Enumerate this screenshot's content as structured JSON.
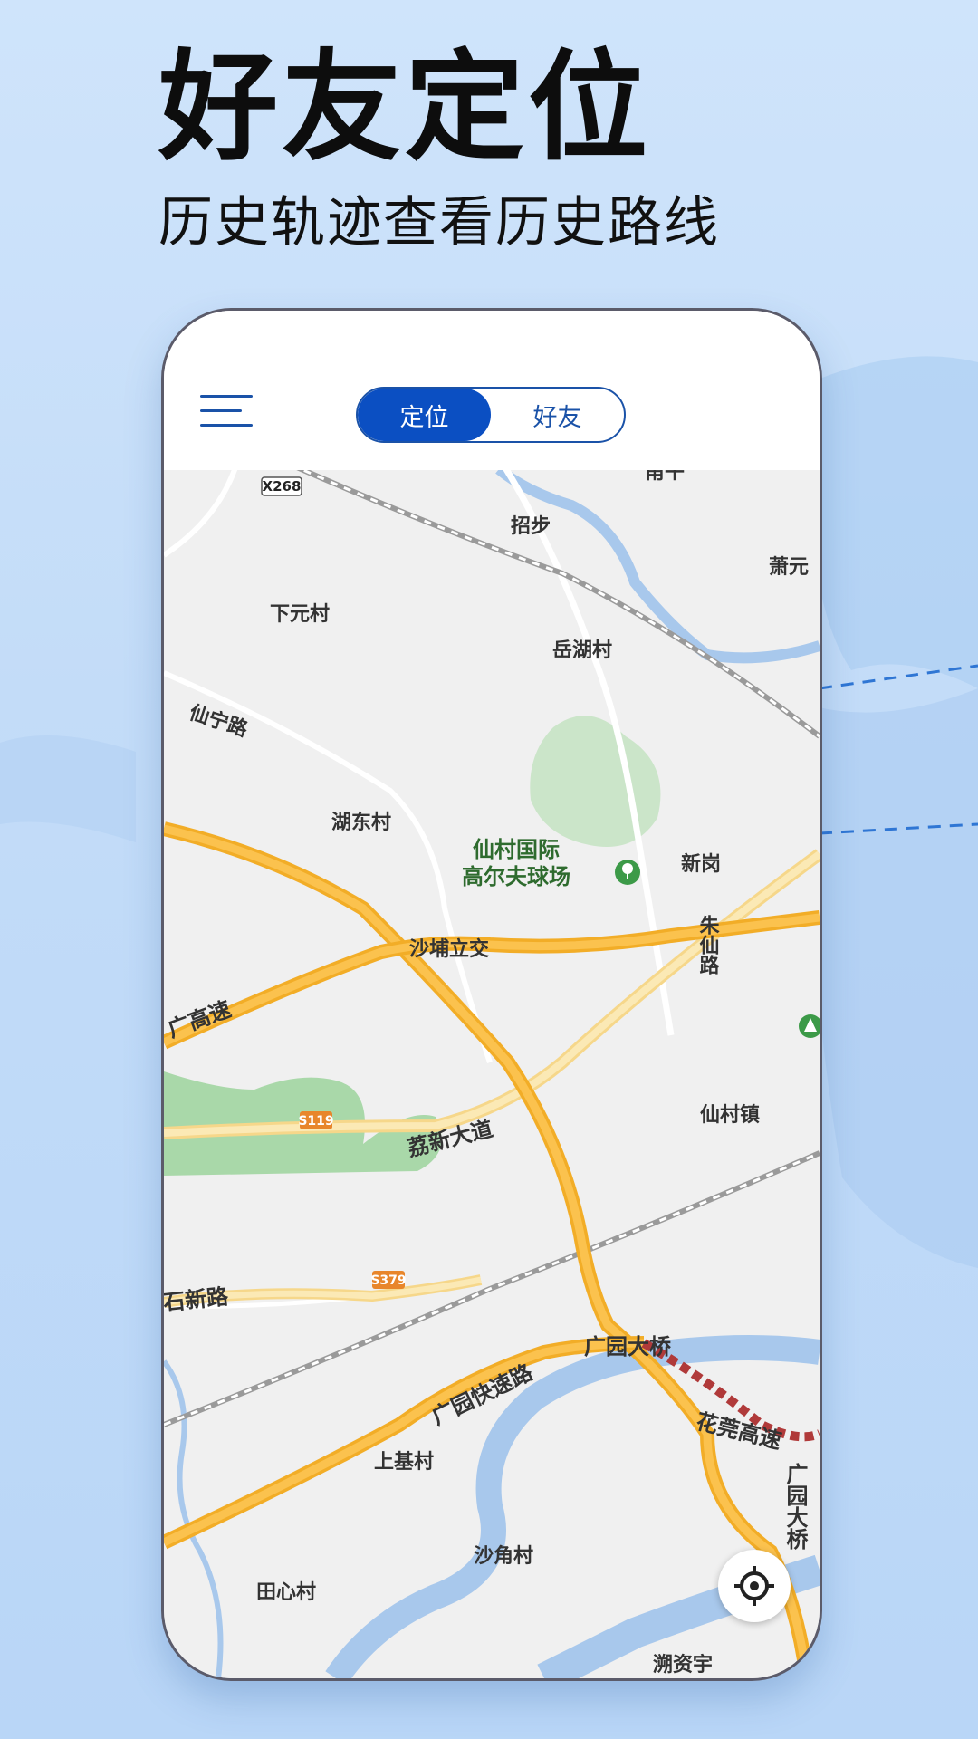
{
  "promo": {
    "title": "好友定位",
    "subtitle": "历史轨迹查看历史路线"
  },
  "app": {
    "tabs": [
      {
        "label": "定位",
        "active": true
      },
      {
        "label": "好友",
        "active": false
      }
    ],
    "menu_icon": "hamburger-menu-icon",
    "locate_icon": "locate-crosshair-icon",
    "accent_color": "#0b4fc2"
  },
  "map": {
    "road_shields": [
      "X268",
      "S119",
      "S379"
    ],
    "place_labels": [
      "招步",
      "萧元",
      "下元村",
      "岳湖村",
      "湖东村",
      "新岗",
      "仙村镇",
      "上基村",
      "沙角村",
      "田心村",
      "溯资宇",
      "甬午"
    ],
    "road_labels": [
      "仙宁路",
      "沙埔立交",
      "朱仙路",
      "广高速",
      "荔新大道",
      "石新路",
      "广园快速路",
      "广园大桥",
      "花莞高速",
      "广园大桥"
    ],
    "poi": {
      "name_line1": "仙村国际",
      "name_line2": "高尔夫球场",
      "icon": "golf-icon"
    },
    "poi_edge_icon": "green-poi-icon"
  }
}
